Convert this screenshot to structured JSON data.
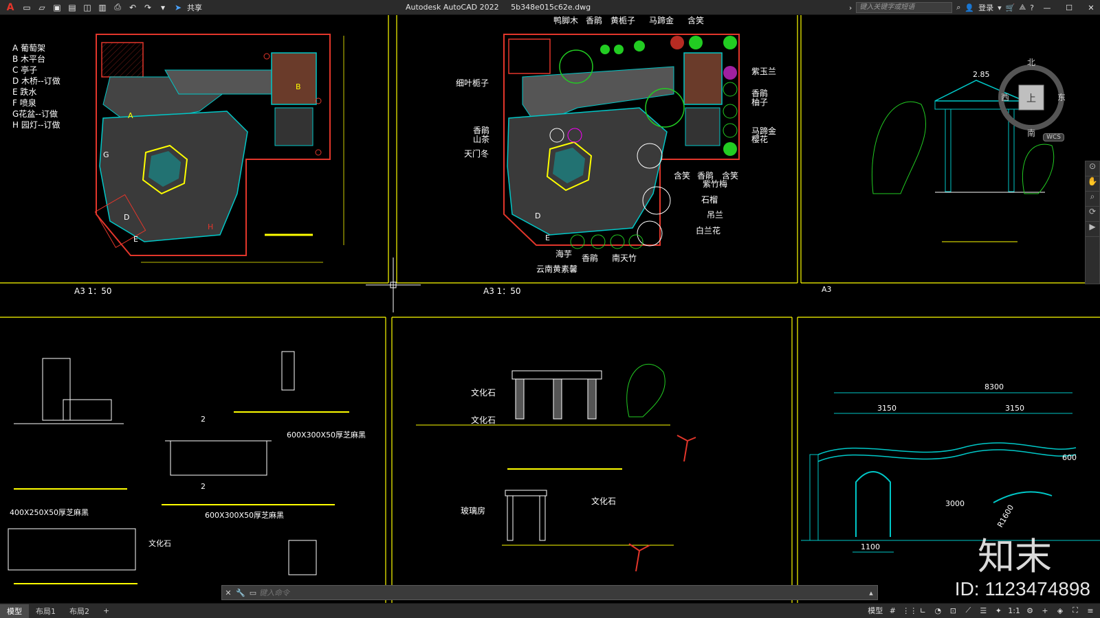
{
  "app": {
    "title": "Autodesk AutoCAD 2022",
    "file": "5b348e015c62e.dwg",
    "share_label": "共享",
    "search_placeholder": "键入关键字或短语",
    "login_label": "登录"
  },
  "quick_access": [
    "new-icon",
    "open-icon",
    "save-icon",
    "saveas-icon",
    "web-save-icon",
    "plot-publish-icon",
    "print-icon",
    "undo-icon",
    "redo-icon",
    "dropdown-icon"
  ],
  "colors": {
    "accent_red": "#e3362b",
    "frame": "#ffff00",
    "cyan": "#00c8c8",
    "green": "#22cc22",
    "magenta": "#ff00ff",
    "white": "#ffffff"
  },
  "drawing": {
    "legend": [
      "A 葡萄架",
      "B 木平台",
      "C 亭子",
      "D 木桥--订做",
      "E 跌水",
      "F 喷泉",
      "G花盆--订做",
      "H 园灯--订做"
    ],
    "plan1_scale": "A3  1：50",
    "plan2_scale": "A3  1：50",
    "elev_scale": "A3",
    "plants_top": [
      "鸭脚木",
      "香鹃",
      "黄栀子",
      "马蹄金",
      "含笑"
    ],
    "plants_left": [
      "细叶栀子",
      "香鹃",
      "山茶",
      "天门冬"
    ],
    "plants_right": [
      "紫玉兰",
      "香鹃",
      "柚子",
      "马蹄金",
      "樱花"
    ],
    "plants_bottom_right": [
      "含笑",
      "香鹃",
      "含笑",
      "紫竹梅",
      "石榴",
      "吊兰",
      "白兰花"
    ],
    "plants_bottom": [
      "海芋",
      "香鹃",
      "南天竹",
      "云南黄素馨"
    ],
    "elev_value": "2.85",
    "section_labels": [
      "600X300X50厚芝麻黑",
      "600X300X50厚芝麻黑",
      "400X250X50厚芝麻黑",
      "文化石"
    ],
    "section_num": [
      "2",
      "2"
    ],
    "elev2_labels": [
      "文化石",
      "文化石",
      "玻璃房",
      "文化石"
    ],
    "wall_dims": [
      "8300",
      "3150",
      "3150",
      "1100",
      "3000",
      "600"
    ],
    "radius_label": "R1600",
    "compass": {
      "n": "北",
      "s": "南",
      "e": "东",
      "w": "西",
      "top": "上",
      "wcs": "WCS"
    }
  },
  "command": {
    "placeholder": "键入命令"
  },
  "status": {
    "tabs": [
      "模型",
      "布局1",
      "布局2"
    ],
    "model_label": "模型",
    "scale": "1:1"
  },
  "watermark": {
    "id": "ID: 1123474898",
    "logo": "知末"
  }
}
